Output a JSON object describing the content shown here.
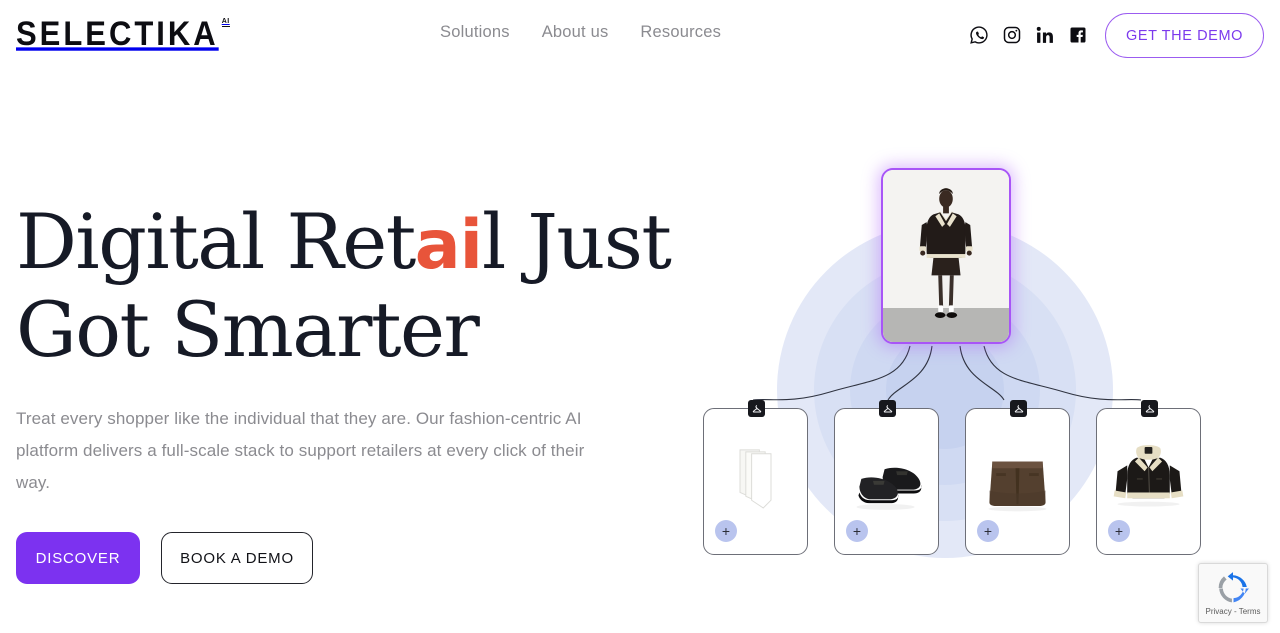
{
  "brand": {
    "logo_text": "SELECTIKA",
    "logo_superscript": "AI",
    "accent_purple": "#7c32f0",
    "accent_purple_border": "#9b5cf0",
    "accent_orange": "#e8543a",
    "headline_color": "#161a26",
    "muted_text": "#8b8b90"
  },
  "header": {
    "nav": [
      {
        "label": "Solutions"
      },
      {
        "label": "About us"
      },
      {
        "label": "Resources"
      }
    ],
    "socials": [
      {
        "name": "whatsapp-icon",
        "label": "WhatsApp"
      },
      {
        "name": "instagram-icon",
        "label": "Instagram"
      },
      {
        "name": "linkedin-icon",
        "label": "LinkedIn"
      },
      {
        "name": "facebook-icon",
        "label": "Facebook"
      }
    ],
    "cta_label": "GET THE DEMO"
  },
  "hero": {
    "headline_part1": "Digital Ret",
    "headline_accent": "ai",
    "headline_part2": "l Just",
    "headline_line2": "Got Smarter",
    "subtext": "Treat every shopper like the individual that they are. Our fashion-centric AI platform delivers a full-scale stack to support retailers at every click of their way.",
    "primary_cta": "DISCOVER",
    "secondary_cta": "BOOK A DEMO"
  },
  "graphic": {
    "hero_card": {
      "name": "model-outfit-card",
      "alt": "Model wearing black shearling jacket, brown leather mini skirt, tights and black loafers"
    },
    "product_cards": [
      {
        "name": "product-card-paper-stack",
        "alt": "Stack of white paper cards",
        "plus_label": "+"
      },
      {
        "name": "product-card-loafers",
        "alt": "Black leather penny loafers",
        "plus_label": "+"
      },
      {
        "name": "product-card-skirt",
        "alt": "Brown leather mini skirt",
        "plus_label": "+"
      },
      {
        "name": "product-card-jacket",
        "alt": "Black and cream shearling biker jacket",
        "plus_label": "+"
      }
    ]
  },
  "recaptcha": {
    "text": "Privacy - Terms"
  }
}
